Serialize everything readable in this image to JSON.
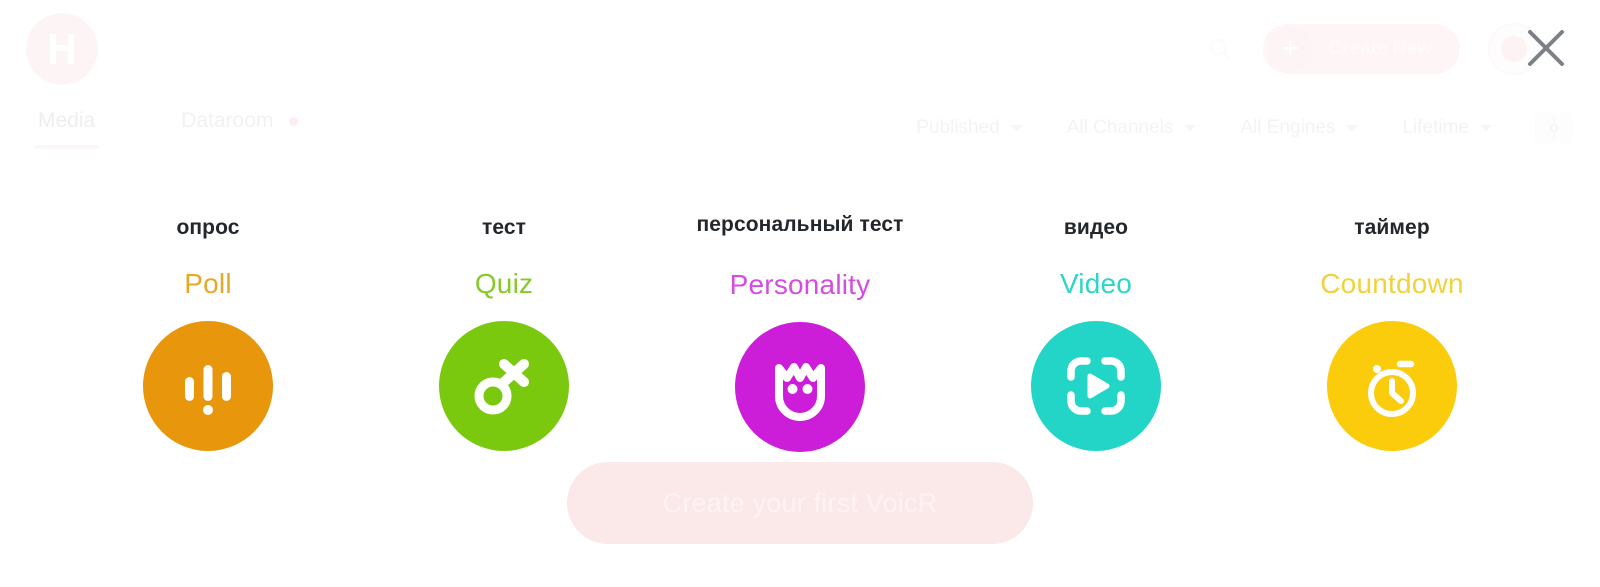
{
  "header": {
    "logo_icon": "voicr-logo-icon",
    "search_icon": "search-icon",
    "create_new_label": "Create New",
    "create_new_plus": "+",
    "avatar_icon": "user-avatar",
    "close_icon": "close-icon"
  },
  "subbar": {
    "tabs": [
      {
        "label": "Media",
        "active": true,
        "dot": false
      },
      {
        "label": "Dataroom",
        "active": false,
        "dot": true
      }
    ],
    "filters": [
      {
        "label": "Published"
      },
      {
        "label": "All Channels"
      },
      {
        "label": "All Engines"
      },
      {
        "label": "Lifetime"
      }
    ],
    "filter_icon": "settings-icon"
  },
  "main": {
    "types": [
      {
        "ru_label": "опрос",
        "en_label": "Poll",
        "icon": "poll-bars-icon",
        "text_color": "#e5a927",
        "circle_color": "#e8960c"
      },
      {
        "ru_label": "тест",
        "en_label": "Quiz",
        "icon": "quiz-ox-icon",
        "text_color": "#86c92a",
        "circle_color": "#7bc90e"
      },
      {
        "ru_label": "персональный тест",
        "en_label": "Personality",
        "icon": "personality-cat-icon",
        "text_color": "#d44de0",
        "circle_color": "#cc1ed8"
      },
      {
        "ru_label": "видео",
        "en_label": "Video",
        "icon": "video-play-icon",
        "text_color": "#2fd5c8",
        "circle_color": "#23d5c6"
      },
      {
        "ru_label": "таймер",
        "en_label": "Countdown",
        "icon": "countdown-stopwatch-icon",
        "text_color": "#f0d23c",
        "circle_color": "#fbcc0b"
      }
    ]
  },
  "cta": {
    "label": "Create your first VoicR"
  }
}
